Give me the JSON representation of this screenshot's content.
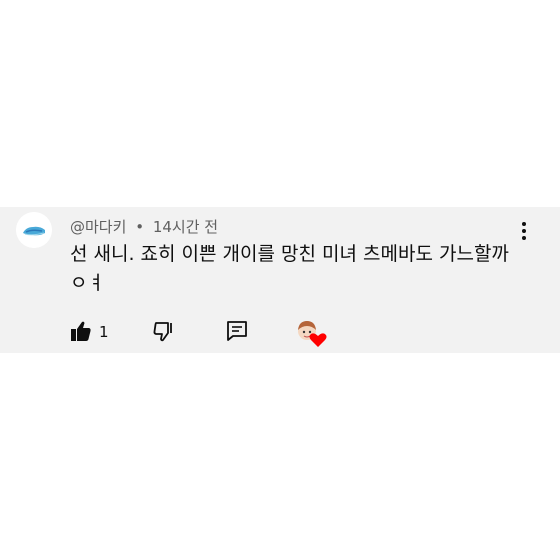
{
  "comment": {
    "author": "@마다키",
    "separator": "•",
    "time": "14시간 전",
    "text": "선 새니. 죠히 이쁜 개이를 망친 미녀 츠메바도 가느할까 ㅇㅕ",
    "like_count": "1"
  },
  "icons": {
    "more": "more-vert-icon",
    "like": "thumbs-up-filled-icon",
    "dislike": "thumbs-down-outline-icon",
    "reply": "reply-comment-icon",
    "creator_heart": "creator-heart-icon"
  },
  "colors": {
    "comment_bg": "#f2f2f2",
    "text": "#0f0f0f",
    "meta": "#606060",
    "heart": "#ff0000"
  }
}
